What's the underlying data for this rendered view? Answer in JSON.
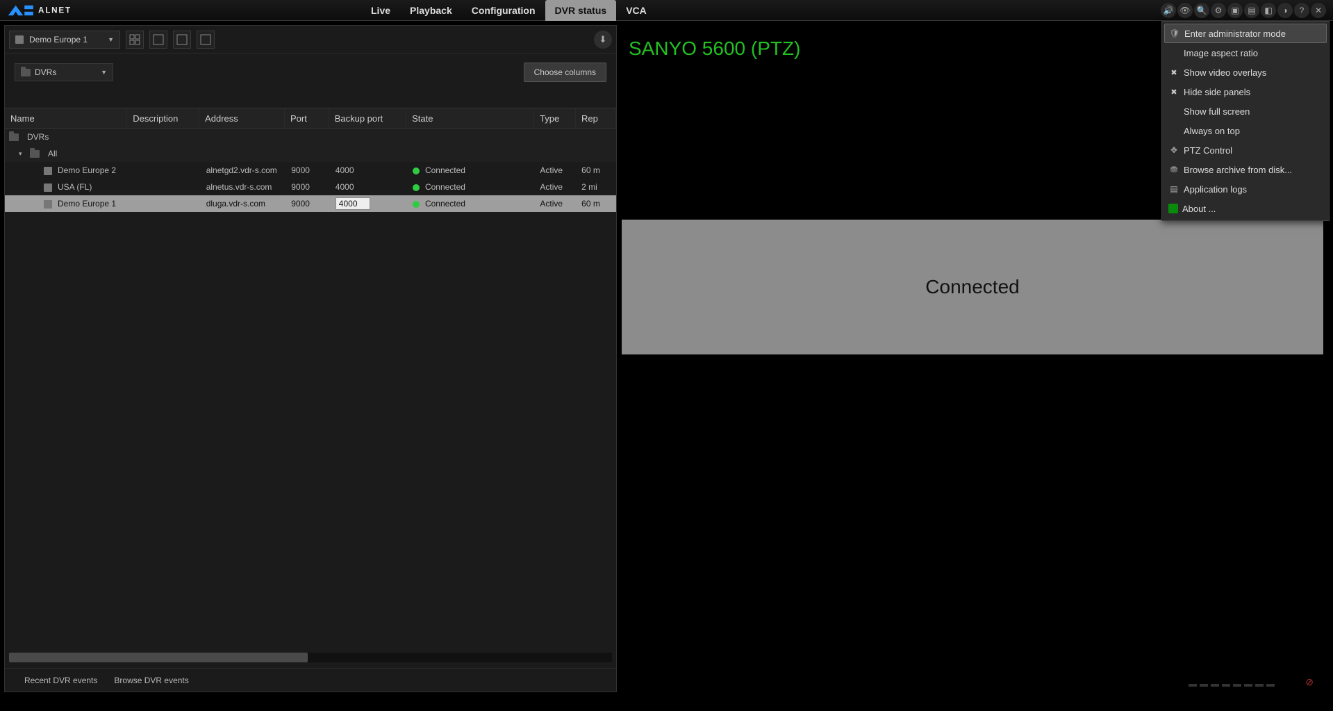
{
  "brand": "ALNET",
  "main_tabs": {
    "live": "Live",
    "playback": "Playback",
    "config": "Configuration",
    "dvrstatus": "DVR status",
    "vca": "VCA"
  },
  "dvr_select": "Demo Europe 1",
  "dvrs_drop": "DVRs",
  "choose_columns": "Choose columns",
  "columns": {
    "name": "Name",
    "description": "Description",
    "address": "Address",
    "port": "Port",
    "backup": "Backup port",
    "state": "State",
    "type": "Type",
    "rep": "Rep"
  },
  "tree": {
    "root": "DVRs",
    "all": "All"
  },
  "rows": [
    {
      "name": "Demo Europe 2",
      "address": "alnetgd2.vdr-s.com",
      "port": "9000",
      "backup": "4000",
      "state": "Connected",
      "type": "Active",
      "rep": "60 m"
    },
    {
      "name": "USA (FL)",
      "address": "alnetus.vdr-s.com",
      "port": "9000",
      "backup": "4000",
      "state": "Connected",
      "type": "Active",
      "rep": "2 mi"
    },
    {
      "name": "Demo Europe 1",
      "address": "dluga.vdr-s.com",
      "port": "9000",
      "backup": "4000",
      "state": "Connected",
      "type": "Active",
      "rep": "60 m"
    }
  ],
  "bottom_tabs": {
    "recent": "Recent DVR events",
    "browse": "Browse DVR events"
  },
  "camera_title": "SANYO 5600 (PTZ)",
  "video_status": "Connected",
  "ctx": {
    "admin": "Enter administrator mode",
    "aspect": "Image aspect ratio",
    "overlays": "Show video overlays",
    "hideside": "Hide side panels",
    "fullscreen": "Show full screen",
    "ontop": "Always on top",
    "ptz": "PTZ Control",
    "archive": "Browse archive from disk...",
    "logs": "Application logs",
    "about": "About ..."
  }
}
